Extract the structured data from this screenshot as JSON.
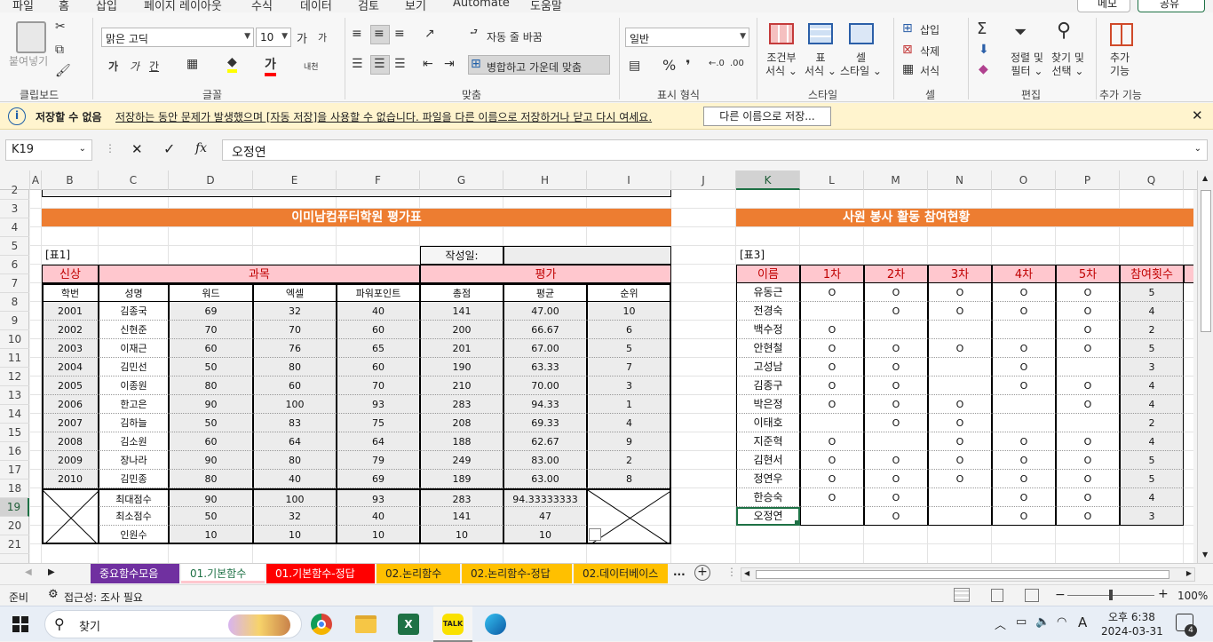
{
  "ribbon_tabs": [
    "파일",
    "홈",
    "삽입",
    "페이지 레이아웃",
    "수식",
    "데이터",
    "검토",
    "보기",
    "Automate",
    "도움말"
  ],
  "memo_button": "메모",
  "share_button": "공유",
  "clipboard": {
    "paste": "붙여넣기",
    "label": "클립보드"
  },
  "font": {
    "name": "맑은 고딕",
    "size": "10",
    "label": "글꼴",
    "grow": "가",
    "shrink": "가",
    "bold": "가",
    "italic": "가",
    "underline": "간",
    "phonetic": "내천"
  },
  "alignment": {
    "wrap": "자동 줄 바꿈",
    "merge": "병합하고 가운데 맞춤",
    "label": "맞춤"
  },
  "number": {
    "format": "일반",
    "label": "표시 형식"
  },
  "styles": {
    "conditional": "조건부\n서식",
    "table": "표\n서식",
    "cell": "셀\n스타일",
    "label": "스타일"
  },
  "cells": {
    "insert": "삽입",
    "delete": "삭제",
    "format": "서식",
    "label": "셀"
  },
  "editing": {
    "sort": "정렬 및\n필터",
    "find": "찾기 및\n선택",
    "label": "편집"
  },
  "addins": {
    "button": "추가\n기능",
    "label": "추가 기능"
  },
  "infobar": {
    "title": "저장할 수 없음",
    "message": "저장하는 동안 문제가 발생했으며 [자동 저장]을 사용할 수 없습니다. 파일을 다른 이름으로 저장하거나 닫고 다시 여세요.",
    "button": "다른 이름으로 저장..."
  },
  "formula_bar": {
    "name_box": "K19",
    "value": "오정연"
  },
  "columns": [
    "A",
    "B",
    "C",
    "D",
    "E",
    "F",
    "G",
    "H",
    "I",
    "J",
    "K",
    "L",
    "M",
    "N",
    "O",
    "P",
    "Q"
  ],
  "rows": [
    "2",
    "3",
    "4",
    "5",
    "6",
    "7",
    "8",
    "9",
    "10",
    "11",
    "12",
    "13",
    "14",
    "15",
    "16",
    "17",
    "18",
    "19",
    "20",
    "21"
  ],
  "table1": {
    "title": "이미남컴퓨터학원 평가표",
    "tag": "[표1]",
    "date_label": "작성일:",
    "group_headers": [
      "신상",
      "과목",
      "평가"
    ],
    "headers": [
      "학번",
      "성명",
      "워드",
      "엑셀",
      "파워포인트",
      "총점",
      "평균",
      "순위"
    ],
    "rows": [
      [
        "2001",
        "김종국",
        "69",
        "32",
        "40",
        "141",
        "47.00",
        "10"
      ],
      [
        "2002",
        "신현준",
        "70",
        "70",
        "60",
        "200",
        "66.67",
        "6"
      ],
      [
        "2003",
        "이재근",
        "60",
        "76",
        "65",
        "201",
        "67.00",
        "5"
      ],
      [
        "2004",
        "김민선",
        "50",
        "80",
        "60",
        "190",
        "63.33",
        "7"
      ],
      [
        "2005",
        "이종원",
        "80",
        "60",
        "70",
        "210",
        "70.00",
        "3"
      ],
      [
        "2006",
        "한고은",
        "90",
        "100",
        "93",
        "283",
        "94.33",
        "1"
      ],
      [
        "2007",
        "김하늘",
        "50",
        "83",
        "75",
        "208",
        "69.33",
        "4"
      ],
      [
        "2008",
        "김소원",
        "60",
        "64",
        "64",
        "188",
        "62.67",
        "9"
      ],
      [
        "2009",
        "장나라",
        "90",
        "80",
        "79",
        "249",
        "83.00",
        "2"
      ],
      [
        "2010",
        "김민종",
        "80",
        "40",
        "69",
        "189",
        "63.00",
        "8"
      ]
    ],
    "summary": [
      [
        "최대점수",
        "90",
        "100",
        "93",
        "283",
        "94.33333333"
      ],
      [
        "최소점수",
        "50",
        "32",
        "40",
        "141",
        "47"
      ],
      [
        "인원수",
        "10",
        "10",
        "10",
        "10",
        "10"
      ]
    ]
  },
  "table3": {
    "title": "사원 봉사 활동 참여현황",
    "tag": "[표3]",
    "headers": [
      "이름",
      "1차",
      "2차",
      "3차",
      "4차",
      "5차",
      "참여횟수"
    ],
    "rows": [
      [
        "유동근",
        "O",
        "O",
        "O",
        "O",
        "O",
        "5"
      ],
      [
        "전경숙",
        "",
        "O",
        "O",
        "O",
        "O",
        "4"
      ],
      [
        "백수정",
        "O",
        "",
        "",
        "",
        "O",
        "2"
      ],
      [
        "안현철",
        "O",
        "O",
        "O",
        "O",
        "O",
        "5"
      ],
      [
        "고성남",
        "O",
        "O",
        "",
        "O",
        "",
        "3"
      ],
      [
        "김종구",
        "O",
        "O",
        "",
        "O",
        "O",
        "4"
      ],
      [
        "박은정",
        "O",
        "O",
        "O",
        "",
        "O",
        "4"
      ],
      [
        "이태호",
        "",
        "O",
        "O",
        "",
        "",
        "2"
      ],
      [
        "지준혁",
        "O",
        "",
        "O",
        "O",
        "O",
        "4"
      ],
      [
        "김현서",
        "O",
        "O",
        "O",
        "O",
        "O",
        "5"
      ],
      [
        "정연우",
        "O",
        "O",
        "O",
        "O",
        "O",
        "5"
      ],
      [
        "한승숙",
        "O",
        "O",
        "",
        "O",
        "O",
        "4"
      ],
      [
        "오정연",
        "",
        "O",
        "",
        "O",
        "O",
        "3"
      ]
    ]
  },
  "sheet_tabs": [
    "중요함수모음",
    "01.기본함수",
    "01.기본함수-정답",
    "02.논리함수",
    "02.논리함수-정답",
    "02.데이터베이스"
  ],
  "sheet_tab_colors": [
    "#7030a0",
    "#ffc7ce",
    "#ff0000",
    "#ffc000",
    "#ffc000",
    "#ffc000"
  ],
  "sheet_more": "...",
  "status": {
    "ready": "준비",
    "accessibility": "접근성: 조사 필요",
    "zoom": "100%"
  },
  "taskbar": {
    "search": "찾기",
    "time": "오후 6:38",
    "date": "2024-03-31",
    "ime": "A",
    "notifications": "4"
  }
}
